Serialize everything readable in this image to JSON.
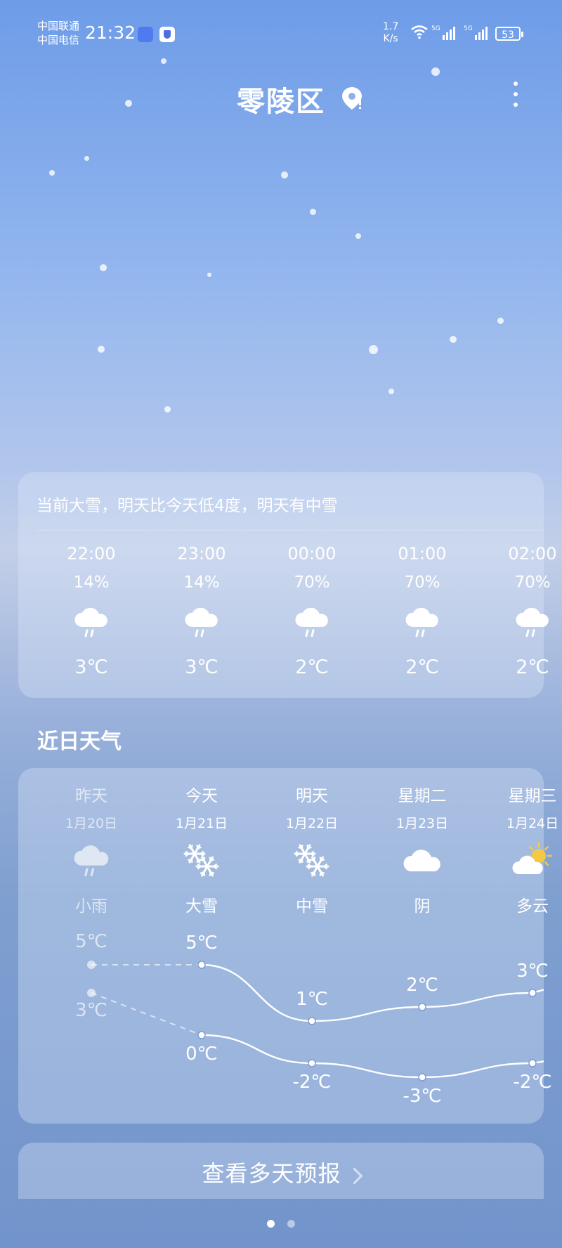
{
  "status_bar": {
    "carrier_1": "中国联通",
    "carrier_2": "中国电信",
    "time": "21:32",
    "speed_value": "1.7",
    "speed_unit": "K/s",
    "net_1": "5G",
    "net_2": "5G",
    "battery": "53"
  },
  "header": {
    "city": "零陵区"
  },
  "hourly": {
    "summary": "当前大雪，明天比今天低4度，明天有中雪",
    "items": [
      {
        "time": "22:00",
        "precip": "14%",
        "icon": "rain-cloud-icon",
        "temp": "3℃"
      },
      {
        "time": "23:00",
        "precip": "14%",
        "icon": "rain-cloud-icon",
        "temp": "3℃"
      },
      {
        "time": "00:00",
        "precip": "70%",
        "icon": "rain-cloud-icon",
        "temp": "2℃"
      },
      {
        "time": "01:00",
        "precip": "70%",
        "icon": "rain-cloud-icon",
        "temp": "2℃"
      },
      {
        "time": "02:00",
        "precip": "70%",
        "icon": "rain-cloud-icon",
        "temp": "2℃"
      }
    ]
  },
  "daily": {
    "title": "近日天气",
    "items": [
      {
        "name": "昨天",
        "date": "1月20日",
        "icon": "rain-cloud-icon",
        "weather": "小雨",
        "high": 5,
        "low": 3,
        "high_label": "5℃",
        "low_label": "3℃"
      },
      {
        "name": "今天",
        "date": "1月21日",
        "icon": "snowflake-icon",
        "weather": "大雪",
        "high": 5,
        "low": 0,
        "high_label": "5℃",
        "low_label": "0℃"
      },
      {
        "name": "明天",
        "date": "1月22日",
        "icon": "snowflake-icon",
        "weather": "中雪",
        "high": 1,
        "low": -2,
        "high_label": "1℃",
        "low_label": "-2℃"
      },
      {
        "name": "星期二",
        "date": "1月23日",
        "icon": "cloud-icon",
        "weather": "阴",
        "high": 2,
        "low": -3,
        "high_label": "2℃",
        "low_label": "-3℃"
      },
      {
        "name": "星期三",
        "date": "1月24日",
        "icon": "partly-cloudy-icon",
        "weather": "多云",
        "high": 3,
        "low": -2,
        "high_label": "3℃",
        "low_label": "-2℃"
      }
    ]
  },
  "more_forecast": {
    "label": "查看多天预报"
  },
  "colors": {
    "sun": "#f6c945",
    "cloud": "#ffffff",
    "rain": "#ffffff"
  }
}
